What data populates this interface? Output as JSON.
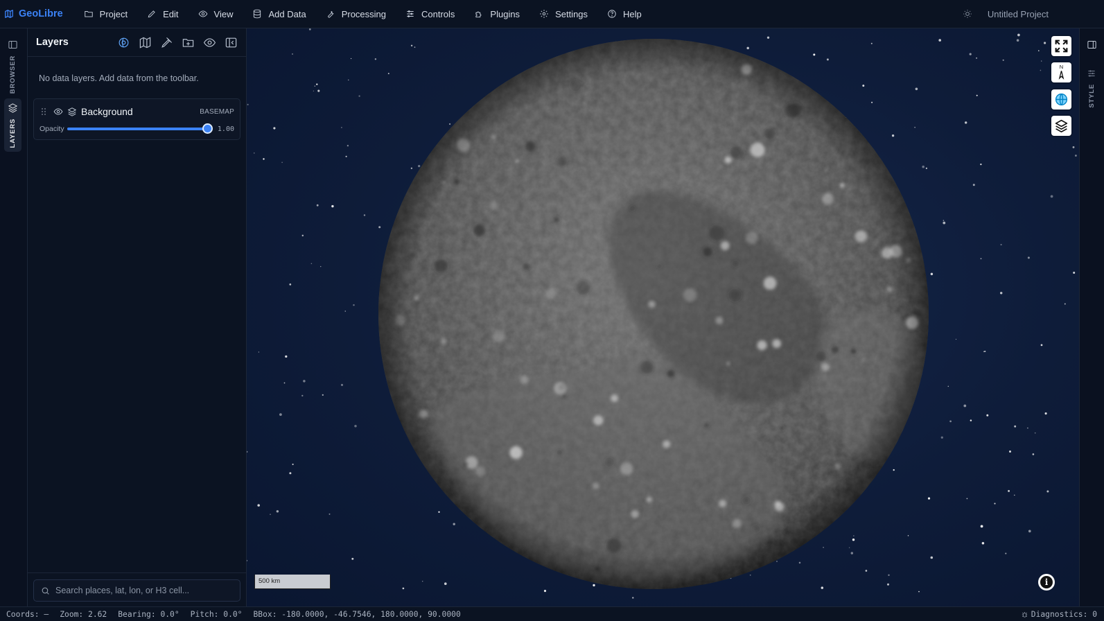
{
  "app": {
    "name": "GeoLibre",
    "project_name": "Untitled Project"
  },
  "menu": [
    {
      "label": "Project",
      "icon": "folder-icon"
    },
    {
      "label": "Edit",
      "icon": "pencil-icon"
    },
    {
      "label": "View",
      "icon": "eye-icon"
    },
    {
      "label": "Add Data",
      "icon": "database-icon"
    },
    {
      "label": "Processing",
      "icon": "wrench-icon"
    },
    {
      "label": "Controls",
      "icon": "sliders-icon"
    },
    {
      "label": "Plugins",
      "icon": "puzzle-icon"
    },
    {
      "label": "Settings",
      "icon": "gear-icon"
    },
    {
      "label": "Help",
      "icon": "help-circle-icon"
    }
  ],
  "left_rail": {
    "browser_label": "BROWSER",
    "layers_label": "LAYERS",
    "active": "layers"
  },
  "layers_panel": {
    "title": "Layers",
    "empty_message": "No data layers. Add data from the toolbar.",
    "tools": [
      "globe-icon",
      "map-icon",
      "draw-icon",
      "add-folder-icon",
      "visibility-icon",
      "collapse-panel-icon"
    ],
    "basemap": {
      "name": "Background",
      "badge": "BASEMAP",
      "opacity_label": "Opacity",
      "opacity": 1.0,
      "opacity_text": "1.00",
      "visible": true
    },
    "search": {
      "placeholder": "Search places, lat, lon, or H3 cell...",
      "value": ""
    }
  },
  "map": {
    "scale_label": "500 km",
    "controls": [
      "fullscreen-icon",
      "compass-icon",
      "globe-projection-icon",
      "layers-icon"
    ],
    "compass_letter": "N",
    "info_label": "i",
    "background_color": "#0e1c39"
  },
  "right_rail": {
    "style_label": "STYLE"
  },
  "status": {
    "coords": "Coords: —",
    "zoom": "Zoom: 2.62",
    "bearing": "Bearing: 0.0°",
    "pitch": "Pitch: 0.0°",
    "bbox": "BBox: -180.0000, -46.7546, 180.0000, 90.0000",
    "diagnostics": "Diagnostics: 0"
  },
  "colors": {
    "accent": "#3b82f6",
    "panel": "#0b1322",
    "map_bg": "#0e1c39"
  }
}
